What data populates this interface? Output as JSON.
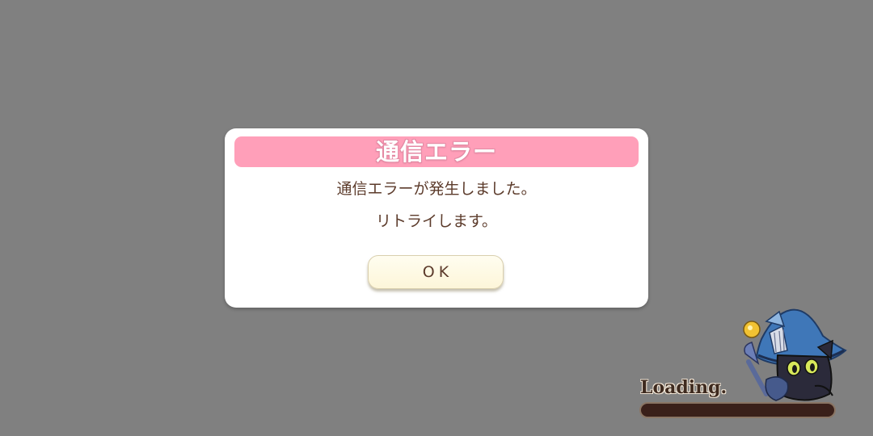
{
  "dialog": {
    "title": "通信エラー",
    "message_line1": "通信エラーが発生しました。",
    "message_line2": "リトライします。",
    "ok_label": "OK"
  },
  "loading": {
    "label": "Loading.",
    "progress": 0
  },
  "colors": {
    "background": "#808080",
    "header_pink": "#ff9fb9",
    "text_brown": "#5c3b2b",
    "button_cream": "#fdf6d9",
    "bar_dark": "#3a201a"
  },
  "icons": {
    "mascot": "black-cat-wizard-icon"
  }
}
